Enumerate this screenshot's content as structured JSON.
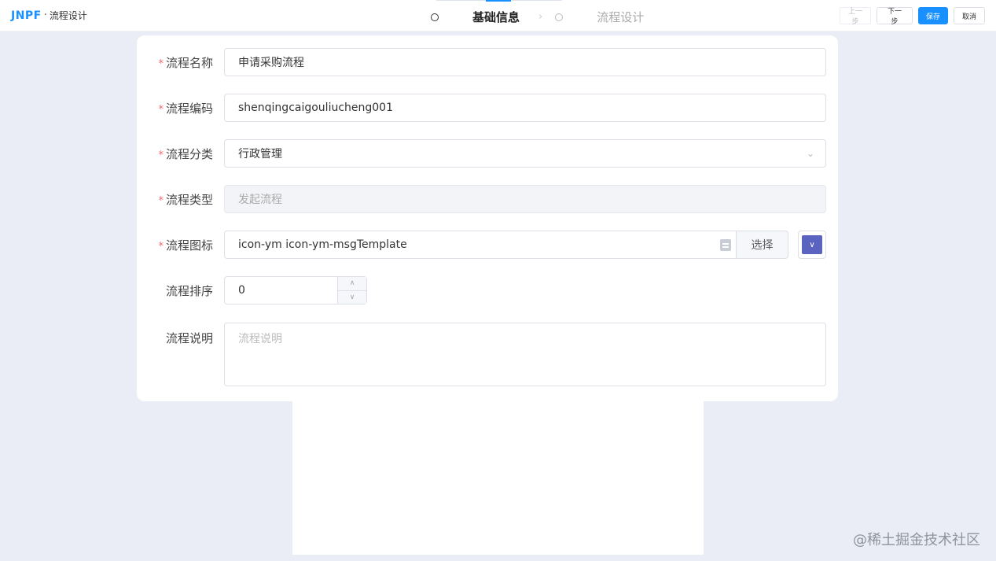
{
  "header": {
    "logo": "JNPF",
    "separator": "·",
    "title": "流程设计",
    "steps": [
      {
        "label": "基础信息",
        "state": "active"
      },
      {
        "label": "流程设计",
        "state": "inactive"
      }
    ],
    "buttons": {
      "prev": "上一步",
      "next": "下一步",
      "save": "保存",
      "cancel": "取消"
    }
  },
  "form": {
    "name": {
      "label": "流程名称",
      "required": true,
      "value": "申请采购流程"
    },
    "code": {
      "label": "流程编码",
      "required": true,
      "value": "shenqingcaigouliucheng001"
    },
    "category": {
      "label": "流程分类",
      "required": true,
      "value": "行政管理"
    },
    "type": {
      "label": "流程类型",
      "required": true,
      "value": "发起流程"
    },
    "icon": {
      "label": "流程图标",
      "required": true,
      "value": "icon-ym icon-ym-msgTemplate",
      "choose_label": "选择",
      "color": "#5b63c0"
    },
    "sort": {
      "label": "流程排序",
      "required": false,
      "value": "0"
    },
    "description": {
      "label": "流程说明",
      "required": false,
      "placeholder": "流程说明"
    }
  },
  "required_mark": "*",
  "watermark": "@稀土掘金技术社区",
  "colors": {
    "primary": "#1890ff",
    "required": "#f56c6c",
    "background": "#eaedf5"
  }
}
